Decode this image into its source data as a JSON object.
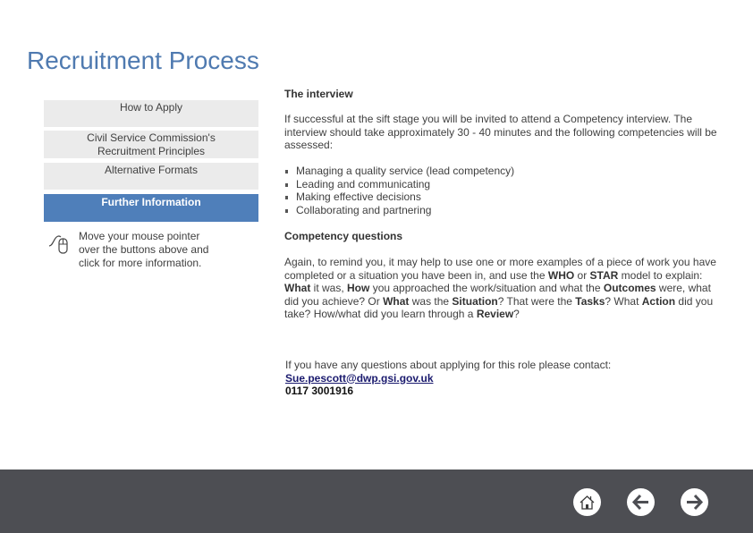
{
  "page": {
    "title": "Recruitment Process"
  },
  "menu": {
    "items": [
      {
        "label": "How to Apply",
        "active": false
      },
      {
        "label": "Civil Service Commission's Recruitment Principles",
        "active": false
      },
      {
        "label": "Alternative Formats",
        "active": false
      },
      {
        "label": "Further Information",
        "active": true
      }
    ],
    "hint_icon": "mouse-icon",
    "hint": "Move your mouse pointer over the buttons above and click for more information."
  },
  "content": {
    "interview_heading": "The interview",
    "interview_text": "If successful at the sift stage you will be invited to attend a Competency interview. The interview should take approximately 30 - 40 minutes and the following competencies will be assessed:",
    "competencies": [
      "Managing a quality service (lead competency)",
      "Leading and communicating",
      "Making effective decisions",
      "Collaborating and partnering"
    ],
    "questions_heading": "Competency questions",
    "questions_text": {
      "t1": "Again, to remind you, it may help to use one or more examples of a piece of work you have completed or a situation you have been in, and use the ",
      "b1": "WHO",
      "t2": " or ",
      "b2": "STAR",
      "t3": " model to explain: ",
      "b3": "What",
      "t4": " it was, ",
      "b4": "How",
      "t5": " you approached the work/situation and what the ",
      "b5": "Outcomes",
      "t6": " were, what did you achieve? Or ",
      "b6": "What",
      "t7": " was the ",
      "b7": "Situation",
      "t8": "? That were the ",
      "b8": "Tasks",
      "t9": "? What ",
      "b9": "Action",
      "t10": " did you take? How/what did you learn through a ",
      "b10": "Review",
      "t11": "?"
    },
    "contact_text": "If you have any questions about applying for this role please contact:",
    "contact_email": "Sue.pescott@dwp.gsi.gov.uk",
    "contact_phone": "0117 3001916"
  },
  "footer": {
    "buttons": [
      {
        "icon": "home-icon",
        "label": "Home"
      },
      {
        "icon": "arrow-left-icon",
        "label": "Back"
      },
      {
        "icon": "arrow-right-icon",
        "label": "Next"
      }
    ]
  },
  "colors": {
    "title": "#4f7ab0",
    "active_button": "#4f7fba",
    "inactive_button": "#ebebeb",
    "footer": "#4d4e53"
  }
}
